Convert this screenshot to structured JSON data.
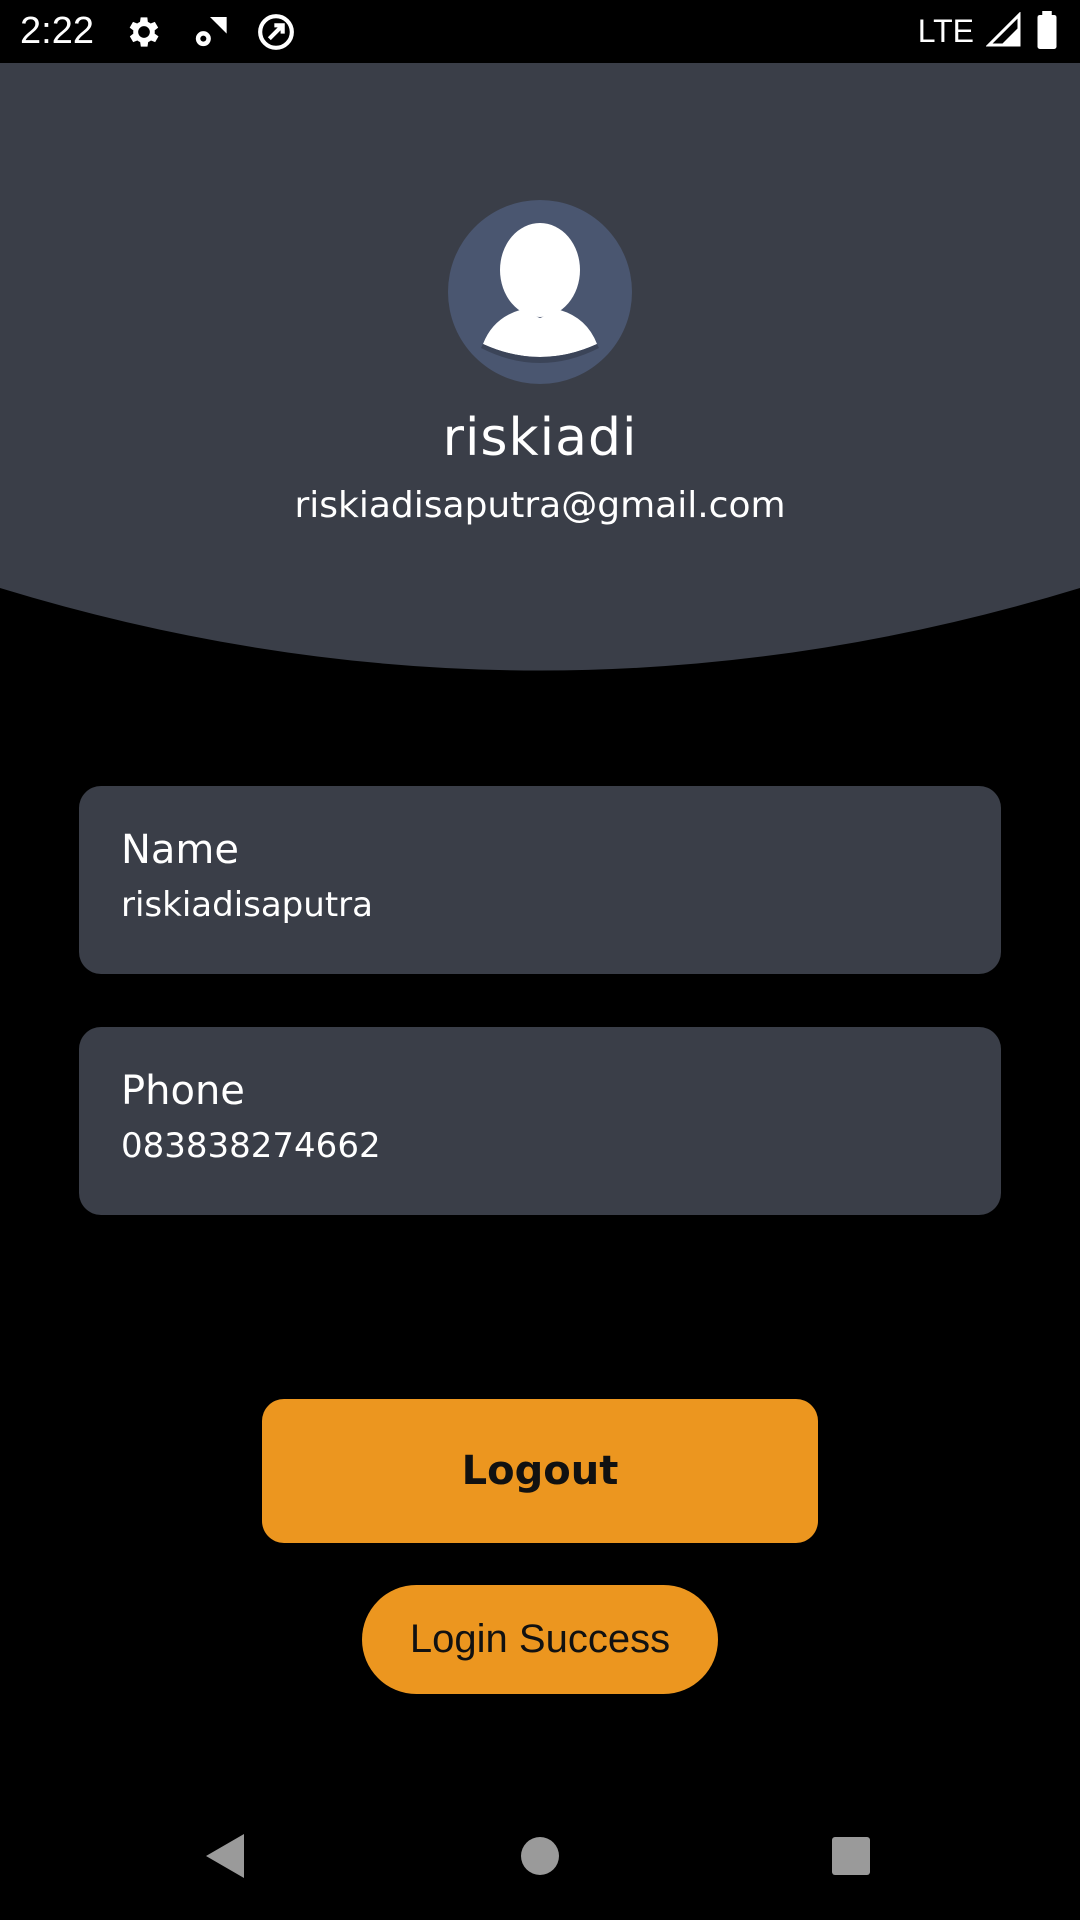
{
  "status_bar": {
    "time": "2:22",
    "network": "LTE",
    "icons": [
      "gear-icon",
      "network-gear-icon",
      "sync-icon",
      "signal-icon",
      "battery-icon"
    ]
  },
  "profile": {
    "name": "riskiadi",
    "email": "riskiadisaputra@gmail.com"
  },
  "fields": {
    "name": {
      "label": "Name",
      "value": "riskiadisaputra"
    },
    "phone": {
      "label": "Phone",
      "value": "083838274662"
    }
  },
  "actions": {
    "logout_label": "Logout"
  },
  "toast": {
    "message": "Login Success"
  },
  "colors": {
    "background": "#000000",
    "header": "#3a3e48",
    "card": "#3a3e48",
    "accent": "#ec961f",
    "avatar_bg": "#4a5670"
  },
  "nav_bar": {
    "icons": [
      "back-icon",
      "home-icon",
      "recents-icon"
    ]
  }
}
